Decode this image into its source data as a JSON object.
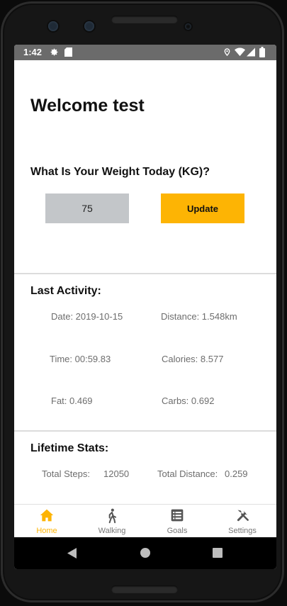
{
  "status_bar": {
    "time": "1:42",
    "left_icons": [
      "gear-icon",
      "sd-card-icon"
    ],
    "right_icons": [
      "location-icon",
      "wifi-icon",
      "signal-icon",
      "battery-icon"
    ]
  },
  "header": {
    "welcome": "Welcome test"
  },
  "weight": {
    "question": "What Is Your Weight Today (KG)?",
    "value": "75",
    "update_label": "Update"
  },
  "last_activity": {
    "title": "Last Activity:",
    "date": "Date: 2019-10-15",
    "distance": "Distance: 1.548km",
    "time": "Time: 00:59.83",
    "calories": "Calories: 8.577",
    "fat": "Fat: 0.469",
    "carbs": "Carbs: 0.692"
  },
  "lifetime": {
    "title": "Lifetime Stats:",
    "steps_label": "Total Steps:",
    "steps_value": "12050",
    "distance_label": "Total Distance:",
    "distance_value": "0.259"
  },
  "bottom_nav": {
    "items": [
      {
        "label": "Home",
        "icon": "home-icon",
        "active": true
      },
      {
        "label": "Walking",
        "icon": "walking-icon",
        "active": false
      },
      {
        "label": "Goals",
        "icon": "list-icon",
        "active": false
      },
      {
        "label": "Settings",
        "icon": "tools-icon",
        "active": false
      }
    ]
  },
  "colors": {
    "accent": "#fdb404",
    "input_bg": "#c3c6c9",
    "status_bar": "#6b6b6b",
    "stat_text": "#6d6d6d"
  }
}
